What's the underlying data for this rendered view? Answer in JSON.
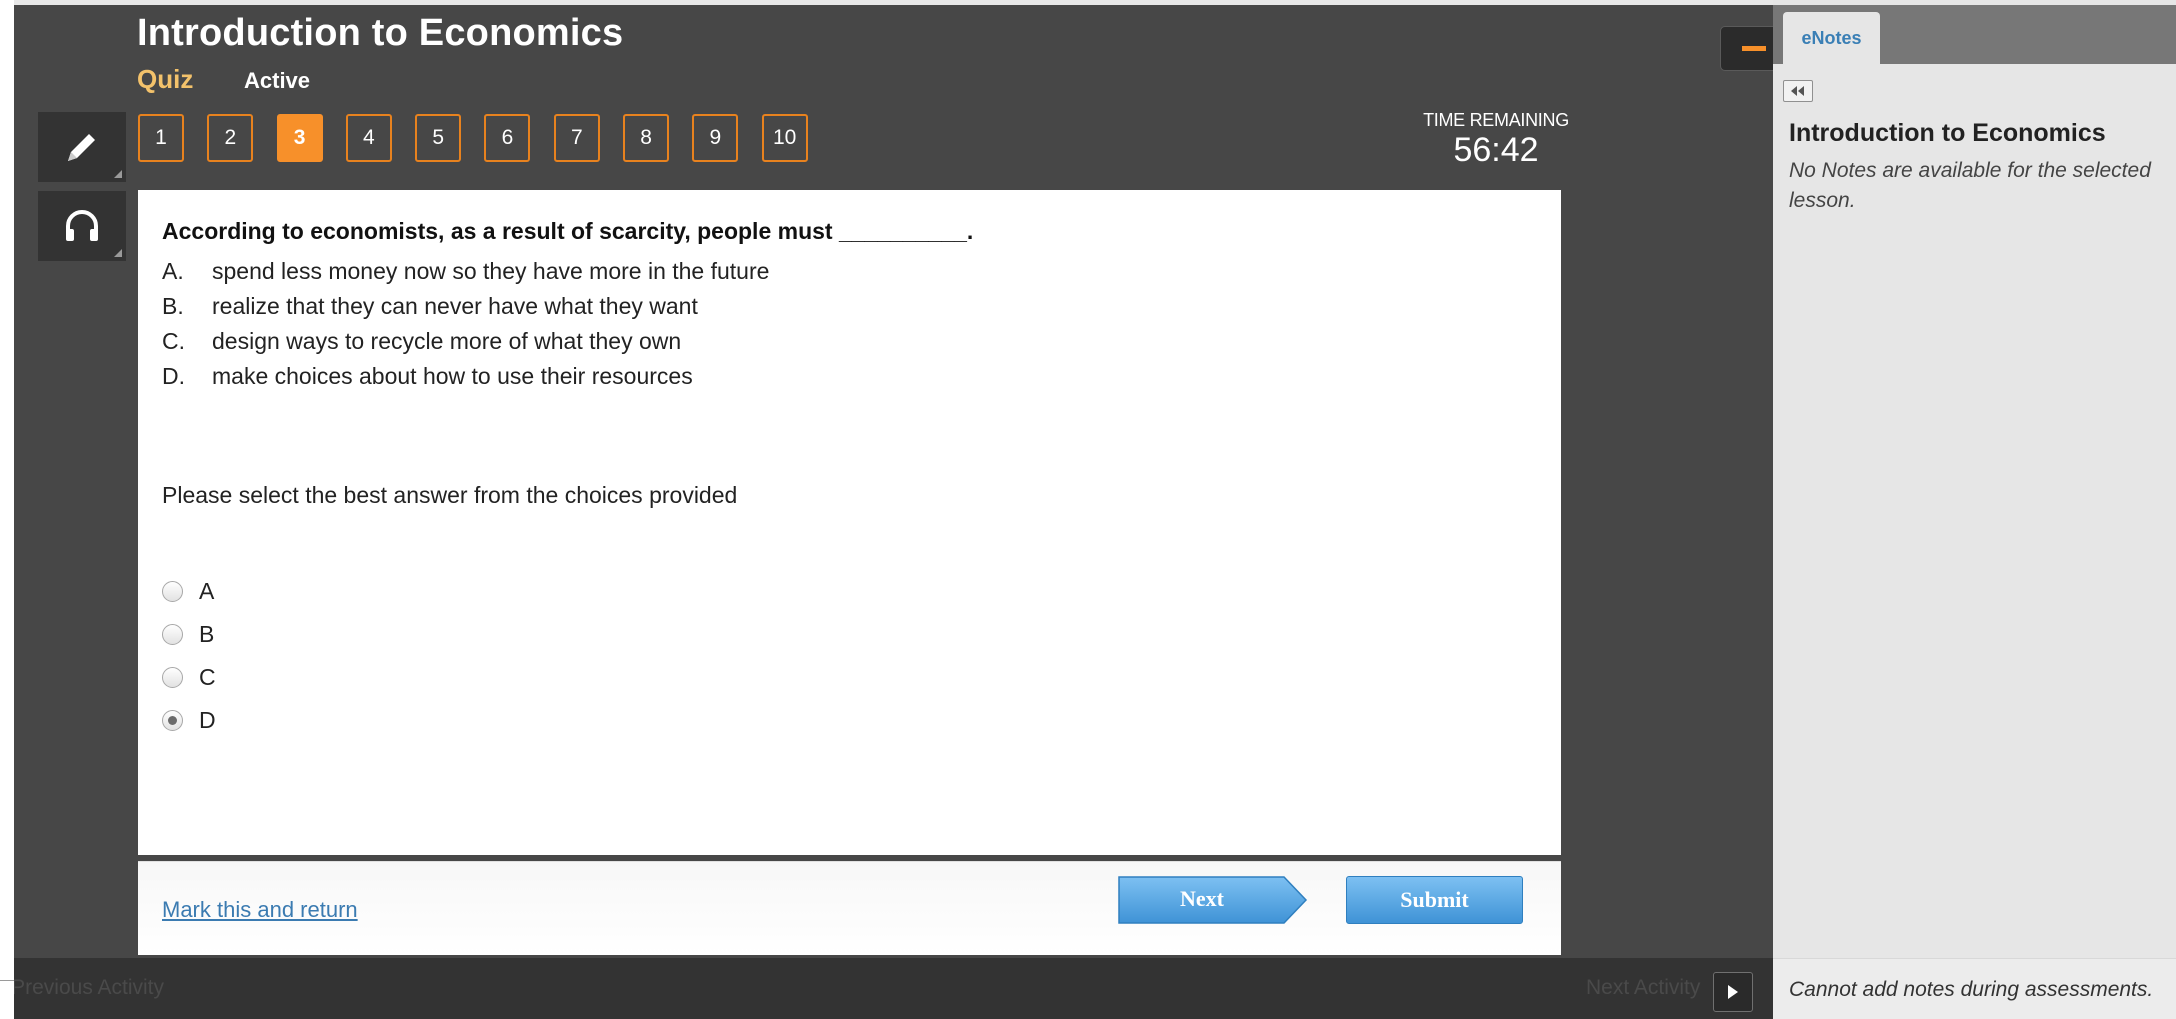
{
  "header": {
    "title": "Introduction to Economics",
    "type_label": "Quiz",
    "status": "Active"
  },
  "tools": [
    {
      "icon": "pencil-icon"
    },
    {
      "icon": "headphones-icon"
    }
  ],
  "question_nav": {
    "numbers": [
      "1",
      "2",
      "3",
      "4",
      "5",
      "6",
      "7",
      "8",
      "9",
      "10"
    ],
    "current": "3"
  },
  "timer": {
    "label": "TIME REMAINING",
    "value": "56:42"
  },
  "question": {
    "text": "According to economists, as a result of scarcity, people must __________.",
    "choices": [
      {
        "letter": "A.",
        "text": "spend less money now so they have more in the future"
      },
      {
        "letter": "B.",
        "text": "realize that they can never have what they want"
      },
      {
        "letter": "C.",
        "text": "design ways to recycle more of what they own"
      },
      {
        "letter": "D.",
        "text": "make choices about how to use their resources"
      }
    ],
    "instruction": "Please select the best answer from the choices provided",
    "options": [
      "A",
      "B",
      "C",
      "D"
    ],
    "selected": "D"
  },
  "footer": {
    "mark_link": "Mark this and return",
    "next_label": "Next",
    "submit_label": "Submit"
  },
  "bottom_nav": {
    "previous": "Previous Activity",
    "next": "Next Activity"
  },
  "enotes": {
    "tab": "eNotes",
    "lesson_title": "Introduction to Economics",
    "empty_message": "No Notes are available for the selected lesson.",
    "footer_message": "Cannot add notes during assessments."
  },
  "colors": {
    "accent": "#f7902a",
    "panel_bg": "#474747",
    "button_blue": "#4a9ee0",
    "link_blue": "#3b7bb1"
  }
}
